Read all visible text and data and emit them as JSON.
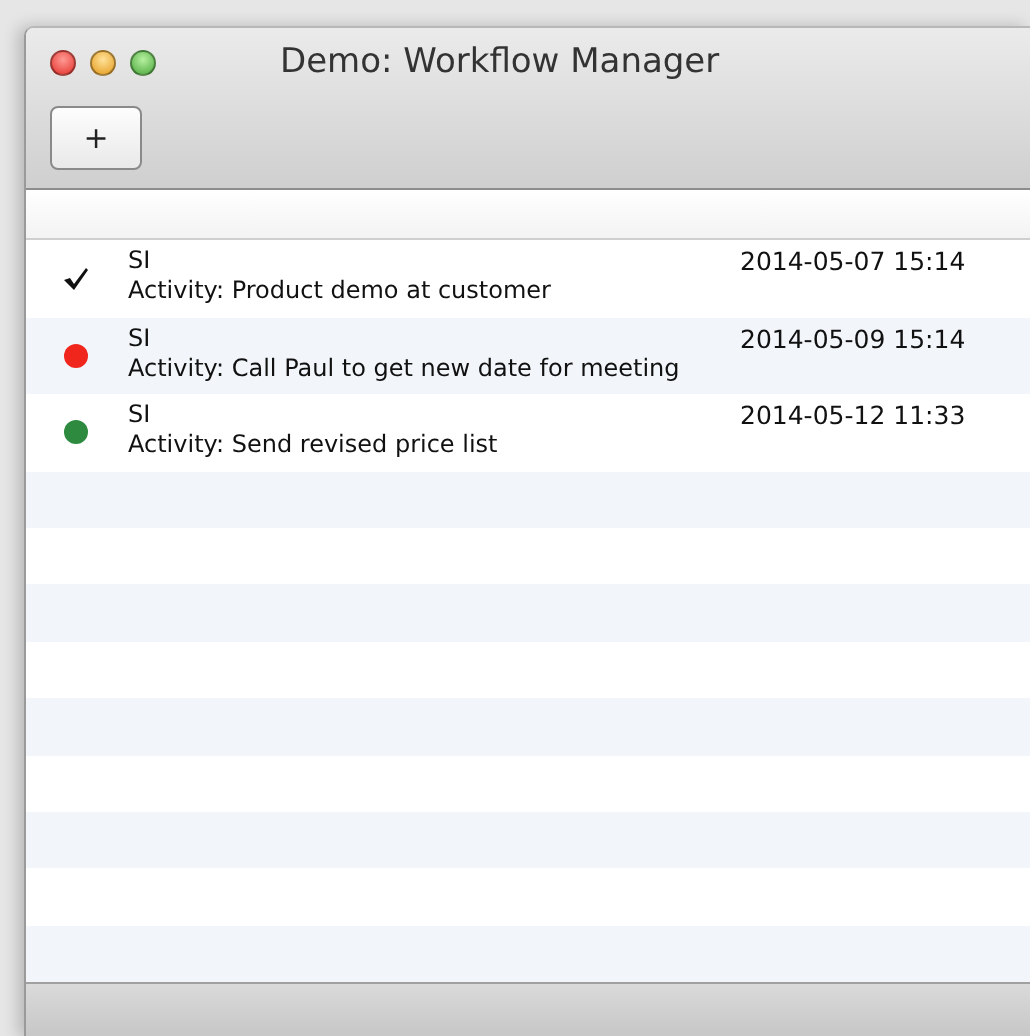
{
  "window": {
    "title": "Demo: Workflow Manager"
  },
  "toolbar": {
    "buttons": [
      "+"
    ]
  },
  "activities": [
    {
      "kind": "check",
      "owner": "SI",
      "description": "Activity: Product demo at customer",
      "date": "2014-05-07 15:14"
    },
    {
      "kind": "dot",
      "color": "#f0261d",
      "owner": "SI",
      "description": "Activity: Call Paul to get new date for meeting",
      "date": "2014-05-09 15:14"
    },
    {
      "kind": "dot",
      "color": "#2d8a3e",
      "owner": "SI",
      "description": "Activity: Send revised price list",
      "date": "2014-05-12 11:33"
    }
  ]
}
